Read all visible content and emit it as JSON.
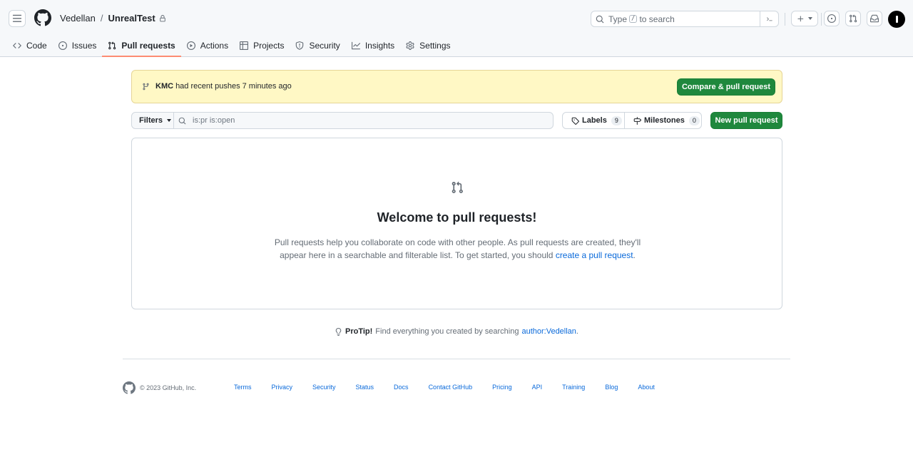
{
  "header": {
    "owner": "Vedellan",
    "separator": "/",
    "repo": "UnrealTest",
    "search_prefix": "Type",
    "search_key": "/",
    "search_suffix": "to search",
    "icons": [
      "hamburger-icon",
      "github-logo-icon",
      "lock-icon",
      "search-icon",
      "command-palette-icon",
      "plus-icon",
      "issue-opened-icon",
      "pull-request-icon",
      "inbox-icon",
      "avatar"
    ]
  },
  "repo_nav": {
    "tabs": [
      {
        "label": "Code",
        "icon": "code-icon"
      },
      {
        "label": "Issues",
        "icon": "issue-opened-icon"
      },
      {
        "label": "Pull requests",
        "icon": "pull-request-icon"
      },
      {
        "label": "Actions",
        "icon": "play-icon"
      },
      {
        "label": "Projects",
        "icon": "table-icon"
      },
      {
        "label": "Security",
        "icon": "shield-icon"
      },
      {
        "label": "Insights",
        "icon": "graph-icon"
      },
      {
        "label": "Settings",
        "icon": "gear-icon"
      }
    ],
    "selected": "Pull requests"
  },
  "banner": {
    "branch": "KMC",
    "message": "had recent pushes 7 minutes ago",
    "button": "Compare & pull request"
  },
  "toolbar": {
    "filters_label": "Filters",
    "search_value": "is:pr is:open",
    "labels_label": "Labels",
    "labels_count": "9",
    "milestones_label": "Milestones",
    "milestones_count": "0",
    "new_pr_label": "New pull request"
  },
  "blankslate": {
    "title": "Welcome to pull requests!",
    "body": "Pull requests help you collaborate on code with other people. As pull requests are created, they'll appear here in a searchable and filterable list. To get started, you should",
    "link": "create a pull request",
    "end": "."
  },
  "protip": {
    "label": "ProTip!",
    "text": "Find everything you created by searching",
    "link": "author:Vedellan",
    "end": "."
  },
  "footer": {
    "copyright": "© 2023 GitHub, Inc.",
    "links": [
      "Terms",
      "Privacy",
      "Security",
      "Status",
      "Docs",
      "Contact GitHub",
      "Pricing",
      "API",
      "Training",
      "Blog",
      "About"
    ]
  },
  "colors": {
    "accent_green": "#1f883d",
    "link_blue": "#0969da",
    "banner_bg": "#fff8c5",
    "selected_tab_underline": "#fd8c73"
  }
}
